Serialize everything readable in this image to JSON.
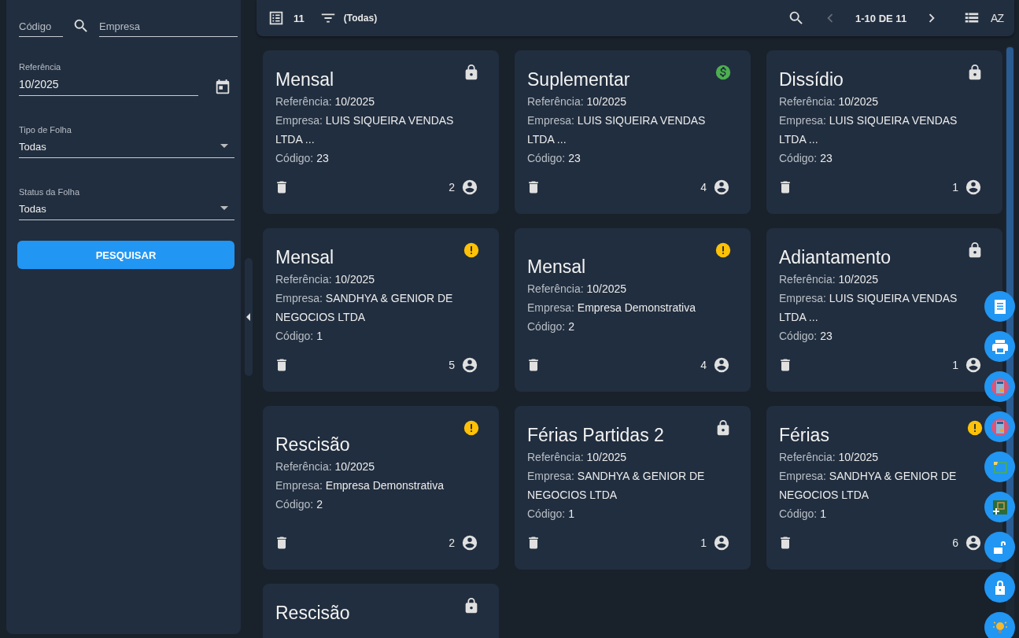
{
  "filters": {
    "codigo": {
      "placeholder": "Código"
    },
    "empresa": {
      "placeholder": "Empresa"
    },
    "referencia": {
      "label": "Referência",
      "value": "10/2025"
    },
    "tipo": {
      "label": "Tipo de Folha",
      "value": "Todas"
    },
    "status": {
      "label": "Status da Folha",
      "value": "Todas"
    },
    "button": "PESQUISAR"
  },
  "toolbar": {
    "count": "11",
    "filter": "(Todas)",
    "prev_disabled": true,
    "next_disabled": false,
    "pagination": "1-10 DE 11",
    "sort": "AZ"
  },
  "cards": [
    {
      "title": "Mensal",
      "kind": "lock",
      "fields": [
        {
          "label": "Referência:",
          "value": "10/2025"
        },
        {
          "label": "Empresa:",
          "value": "LUIS SIQUEIRA VENDAS LTDA ..."
        },
        {
          "label": "Código:",
          "value": "23"
        }
      ],
      "count": "2"
    },
    {
      "title": "Suplementar",
      "kind": "paid",
      "fields": [
        {
          "label": "Referência:",
          "value": "10/2025"
        },
        {
          "label": "Empresa:",
          "value": "LUIS SIQUEIRA VENDAS LTDA ..."
        },
        {
          "label": "Código:",
          "value": "23"
        }
      ],
      "count": "4"
    },
    {
      "title": "Dissídio",
      "kind": "lock",
      "fields": [
        {
          "label": "Referência:",
          "value": "10/2025"
        },
        {
          "label": "Empresa:",
          "value": "LUIS SIQUEIRA VENDAS LTDA ..."
        },
        {
          "label": "Código:",
          "value": "23"
        }
      ],
      "count": "1"
    },
    {
      "title": "Mensal",
      "kind": "warning",
      "fields": [
        {
          "label": "Referência:",
          "value": "10/2025"
        },
        {
          "label": "Empresa:",
          "value": "SANDHYA & GENIOR DE NEGOCIOS LTDA"
        },
        {
          "label": "Código:",
          "value": "1"
        }
      ],
      "count": "5"
    },
    {
      "title": "Mensal",
      "kind": "warning",
      "fields": [
        {
          "label": "Referência:",
          "value": "10/2025"
        },
        {
          "label": "Empresa:",
          "value": "Empresa Demonstrativa"
        },
        {
          "label": "Código:",
          "value": "2"
        }
      ],
      "count": "4"
    },
    {
      "title": "Adiantamento",
      "kind": "lock",
      "fields": [
        {
          "label": "Referência:",
          "value": "10/2025"
        },
        {
          "label": "Empresa:",
          "value": "LUIS SIQUEIRA VENDAS LTDA ..."
        },
        {
          "label": "Código:",
          "value": "23"
        }
      ],
      "count": "1"
    },
    {
      "title": "Rescisão",
      "kind": "warning",
      "fields": [
        {
          "label": "Referência:",
          "value": "10/2025"
        },
        {
          "label": "Empresa:",
          "value": "Empresa Demonstrativa"
        },
        {
          "label": "Código:",
          "value": "2"
        }
      ],
      "count": "2"
    },
    {
      "title": "Férias Partidas 2",
      "kind": "lock",
      "fields": [
        {
          "label": "Referência:",
          "value": "10/2025"
        },
        {
          "label": "Empresa:",
          "value": "SANDHYA & GENIOR DE NEGOCIOS LTDA"
        },
        {
          "label": "Código:",
          "value": "1"
        }
      ],
      "count": "1"
    },
    {
      "title": "Férias",
      "kind": "warning",
      "fields": [
        {
          "label": "Referência:",
          "value": "10/2025"
        },
        {
          "label": "Empresa:",
          "value": "SANDHYA & GENIOR DE NEGOCIOS LTDA"
        },
        {
          "label": "Código:",
          "value": "1"
        }
      ],
      "count": "6"
    },
    {
      "title": "Rescisão",
      "kind": "lock"
    }
  ]
}
